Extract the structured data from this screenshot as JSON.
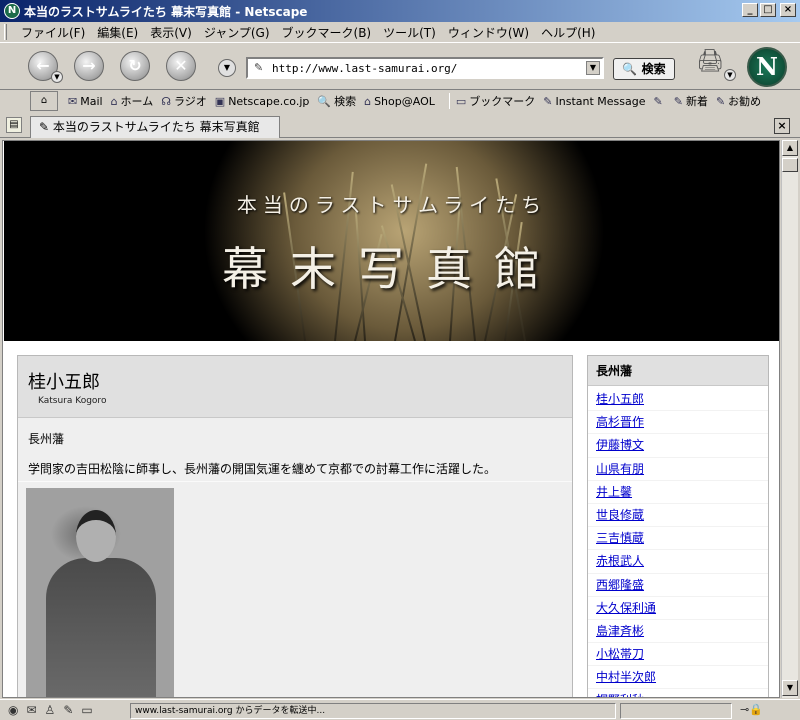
{
  "window": {
    "title": "本当のラストサムライたち 幕末写真館 - Netscape",
    "app_icon_letter": "N",
    "buttons": {
      "minimize": "_",
      "maximize": "□",
      "close": "×"
    }
  },
  "menu": [
    "ファイル(F)",
    "編集(E)",
    "表示(V)",
    "ジャンプ(G)",
    "ブックマーク(B)",
    "ツール(T)",
    "ウィンドウ(W)",
    "ヘルプ(H)"
  ],
  "nav": {
    "url": "http://www.last-samurai.org/",
    "search_label": "検索",
    "logo_letter": "N"
  },
  "personal_toolbar": [
    "Mail",
    "ホーム",
    "ラジオ",
    "Netscape.co.jp",
    "検索",
    "Shop@AOL",
    "ブックマーク",
    "Instant Message",
    "新着",
    "お勧め"
  ],
  "tab": {
    "label": "本当のラストサムライたち 幕末写真館"
  },
  "banner": {
    "subtitle": "本当のラストサムライたち",
    "title": "幕末写真館"
  },
  "person": {
    "name": "桂小五郎",
    "roman": "Katsura Kogoro",
    "clan": "長州藩",
    "description": "学問家の吉田松陰に師事し、長州藩の開国気運を纏めて京都での討幕工作に活躍した。"
  },
  "sidebar": {
    "header": "長州藩",
    "links": [
      "桂小五郎",
      "高杉晋作",
      "伊藤博文",
      "山県有朋",
      "井上馨",
      "世良修蔵",
      "三吉慎蔵",
      "赤根武人",
      "西郷隆盛",
      "大久保利通",
      "島津斉彬",
      "小松帯刀",
      "中村半次郎",
      "桐野利秋"
    ]
  },
  "status": {
    "text": "www.last-samurai.org からデータを転送中..."
  }
}
